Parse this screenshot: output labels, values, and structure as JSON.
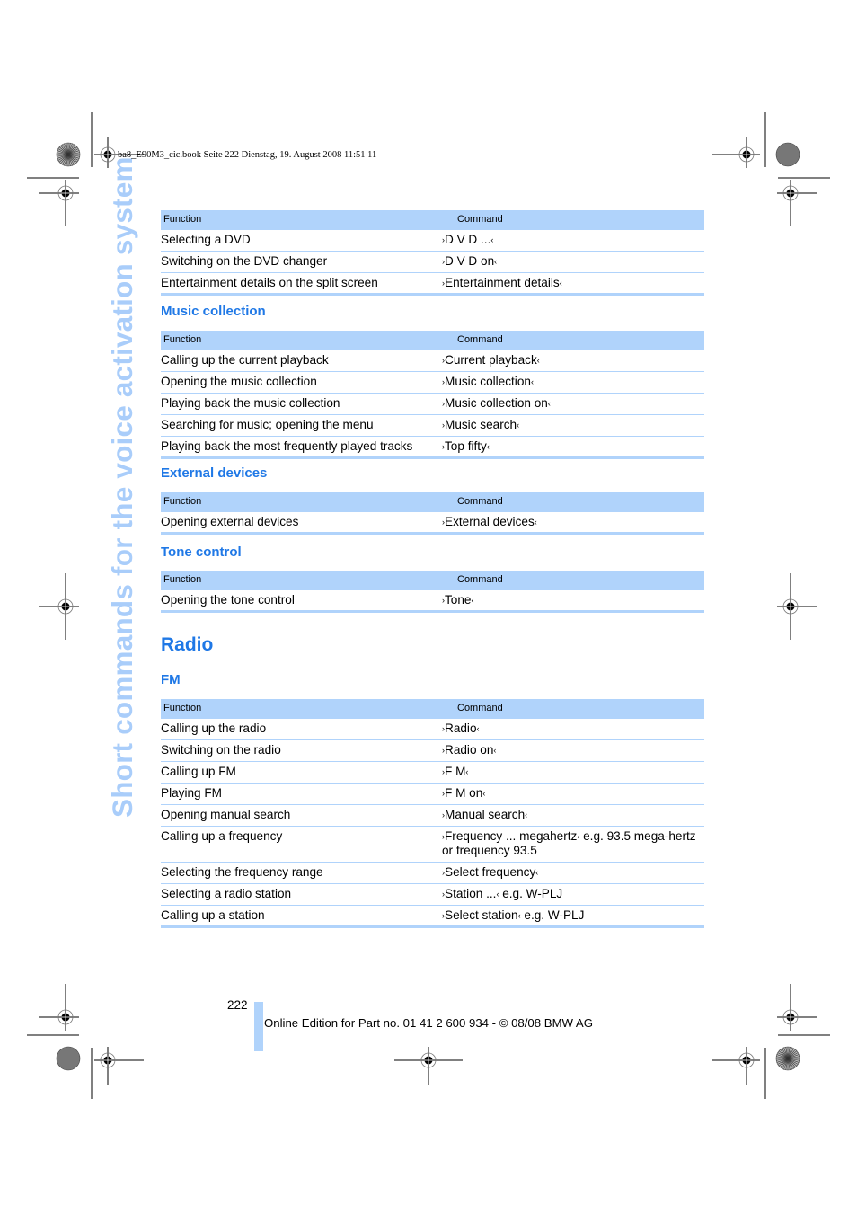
{
  "print_slug": "ba8_E90M3_cic.book  Seite 222  Dienstag, 19. August 2008  11:51 11",
  "side_title": "Short commands for the voice activation system",
  "colors": {
    "heading_blue": "#1f78e6",
    "table_header_bg": "#b0d3fb",
    "side_title": "#a9cdfa"
  },
  "table_headers": {
    "function": "Function",
    "command": "Command"
  },
  "quote_open": "›",
  "quote_close": "‹",
  "sections": {
    "dvd": {
      "rows": [
        {
          "function": "Selecting a DVD",
          "command": "D V D  ...",
          "note": ""
        },
        {
          "function": "Switching on the DVD changer",
          "command": "D V D on",
          "note": ""
        },
        {
          "function": "Entertainment details on the split screen",
          "command": "Entertainment details",
          "note": ""
        }
      ]
    },
    "music": {
      "heading": "Music collection",
      "rows": [
        {
          "function": "Calling up the current playback",
          "command": "Current playback",
          "note": ""
        },
        {
          "function": "Opening the music collection",
          "command": "Music collection",
          "note": ""
        },
        {
          "function": "Playing back the music collection",
          "command": "Music collection on",
          "note": ""
        },
        {
          "function": "Searching for music; opening the menu",
          "command": "Music search",
          "note": ""
        },
        {
          "function": "Playing back the most frequently played tracks",
          "command": "Top fifty",
          "note": ""
        }
      ]
    },
    "external": {
      "heading": "External devices",
      "rows": [
        {
          "function": "Opening external devices",
          "command": "External devices",
          "note": ""
        }
      ]
    },
    "tone": {
      "heading": "Tone control",
      "rows": [
        {
          "function": "Opening the tone control",
          "command": "Tone",
          "note": ""
        }
      ]
    },
    "radio": {
      "heading": "Radio",
      "subheading": "FM",
      "rows": [
        {
          "function": "Calling up the radio",
          "command": "Radio",
          "note": ""
        },
        {
          "function": "Switching on the radio",
          "command": "Radio on",
          "note": ""
        },
        {
          "function": "Calling up FM",
          "command": "F M",
          "note": ""
        },
        {
          "function": "Playing FM",
          "command": "F M on",
          "note": ""
        },
        {
          "function": "Opening manual search",
          "command": "Manual search",
          "note": ""
        },
        {
          "function": "Calling up a frequency",
          "command": "Frequency  ...  megahertz",
          "note": " e.g. 93.5 mega-hertz or frequency 93.5"
        },
        {
          "function": "Selecting the frequency range",
          "command": "Select frequency",
          "note": ""
        },
        {
          "function": "Selecting a radio station",
          "command": "Station  ...",
          "note": " e.g. W-PLJ"
        },
        {
          "function": "Calling up a station",
          "command": "Select station",
          "note": " e.g. W-PLJ"
        }
      ]
    }
  },
  "footer": {
    "page_number": "222",
    "edition": "Online Edition for Part no. 01 41 2 600 934 - © 08/08 BMW AG"
  }
}
